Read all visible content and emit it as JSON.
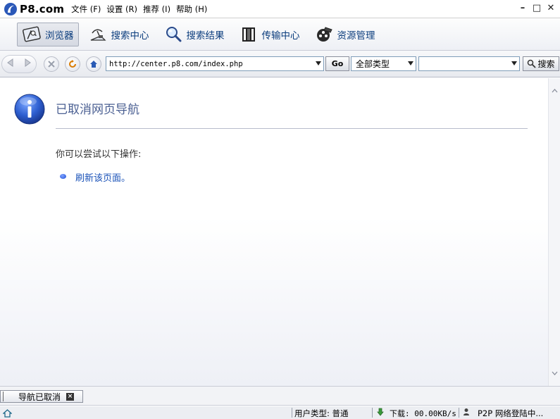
{
  "app": {
    "name": "P8.com",
    "menu": [
      "文件 (F)",
      "设置 (R)",
      "推荐 (I)",
      "帮助 (H)"
    ],
    "window_controls": [
      "–",
      "□",
      "✕"
    ]
  },
  "toolbar": {
    "tabs": [
      {
        "label": "浏览器",
        "icon": "browser-icon",
        "active": true
      },
      {
        "label": "搜索中心",
        "icon": "satellite-icon",
        "active": false
      },
      {
        "label": "搜索结果",
        "icon": "magnifier-icon",
        "active": false
      },
      {
        "label": "传输中心",
        "icon": "film-reel-icon",
        "active": false
      },
      {
        "label": "资源管理",
        "icon": "film-clapper-icon",
        "active": false
      }
    ]
  },
  "addressbar": {
    "url": "http://center.p8.com/index.php",
    "go_label": "Go",
    "type_select": "全部类型",
    "search_value": "",
    "search_label": "搜索"
  },
  "page": {
    "title": "已取消网页导航",
    "try_text": "你可以尝试以下操作:",
    "refresh_link": "刷新该页面。"
  },
  "tabstrip": {
    "tab_label": "导航已取消"
  },
  "statusbar": {
    "user_type": "用户类型: 普通",
    "download": "下载: 00.00KB/s",
    "p2p": "P2P 网络登陆中..."
  },
  "colors": {
    "title_text": "#4a5f92",
    "link": "#1a52b8",
    "toolbar_label": "#0a3c7d"
  }
}
